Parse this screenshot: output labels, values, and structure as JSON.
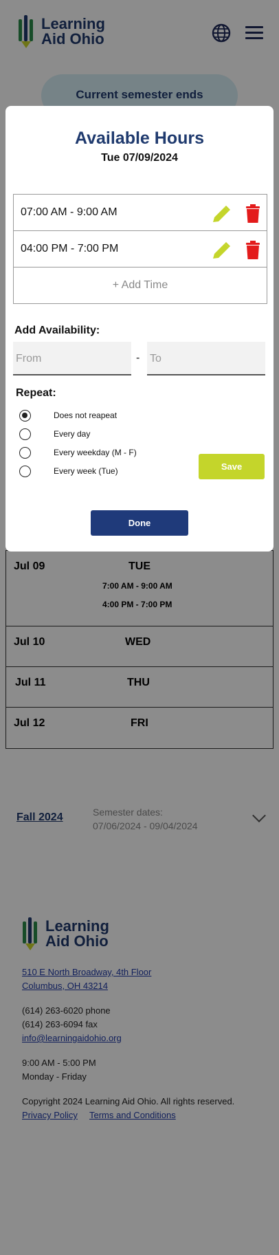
{
  "brand": {
    "name": "Learning Aid Ohio"
  },
  "header": {
    "globe_icon": "globe-icon",
    "menu_icon": "hamburger-menu-icon"
  },
  "semester_banner": "Current semester ends",
  "schedule": [
    {
      "date": "Jul 09",
      "day": "TUE",
      "times": [
        "7:00 AM - 9:00 AM",
        "4:00 PM - 7:00 PM"
      ]
    },
    {
      "date": "Jul 10",
      "day": "WED",
      "times": []
    },
    {
      "date": "Jul 11",
      "day": "THU",
      "times": []
    },
    {
      "date": "Jul 12",
      "day": "FRI",
      "times": []
    }
  ],
  "fall_semester": {
    "name": "Fall 2024",
    "dates_label": "Semester dates:",
    "dates": "07/06/2024 - 09/04/2024"
  },
  "footer": {
    "address1": "510 E North Broadway, 4th Floor",
    "address2": "Columbus, OH 43214",
    "phone": "(614) 263-6020 phone",
    "fax": "(614) 263-6094 fax",
    "email": "info@learningaidohio.org",
    "hours": "9:00 AM - 5:00 PM",
    "days": "Monday - Friday",
    "copyright": "Copyright 2024 Learning Aid Ohio. All rights reserved.",
    "privacy": "Privacy Policy",
    "terms": "Terms and Conditions"
  },
  "modal": {
    "title": "Available Hours",
    "date": "Tue 07/09/2024",
    "slots": [
      {
        "time": "07:00 AM - 9:00 AM"
      },
      {
        "time": "04:00 PM - 7:00 PM"
      }
    ],
    "add_time": "+ Add Time",
    "add_availability": "Add Availability:",
    "from_placeholder": "From",
    "to_placeholder": "To",
    "separator": "-",
    "repeat_label": "Repeat:",
    "repeat_options": [
      {
        "label": "Does not reapeat",
        "selected": true
      },
      {
        "label": "Every day",
        "selected": false
      },
      {
        "label": "Every weekday (M - F)",
        "selected": false
      },
      {
        "label": "Every week (Tue)",
        "selected": false
      }
    ],
    "save": "Save",
    "done": "Done"
  },
  "colors": {
    "primary": "#1f3a6e",
    "accent": "#c4d52b",
    "delete": "#e31b1b",
    "overlay": "rgba(0,0,0,0.45)"
  }
}
